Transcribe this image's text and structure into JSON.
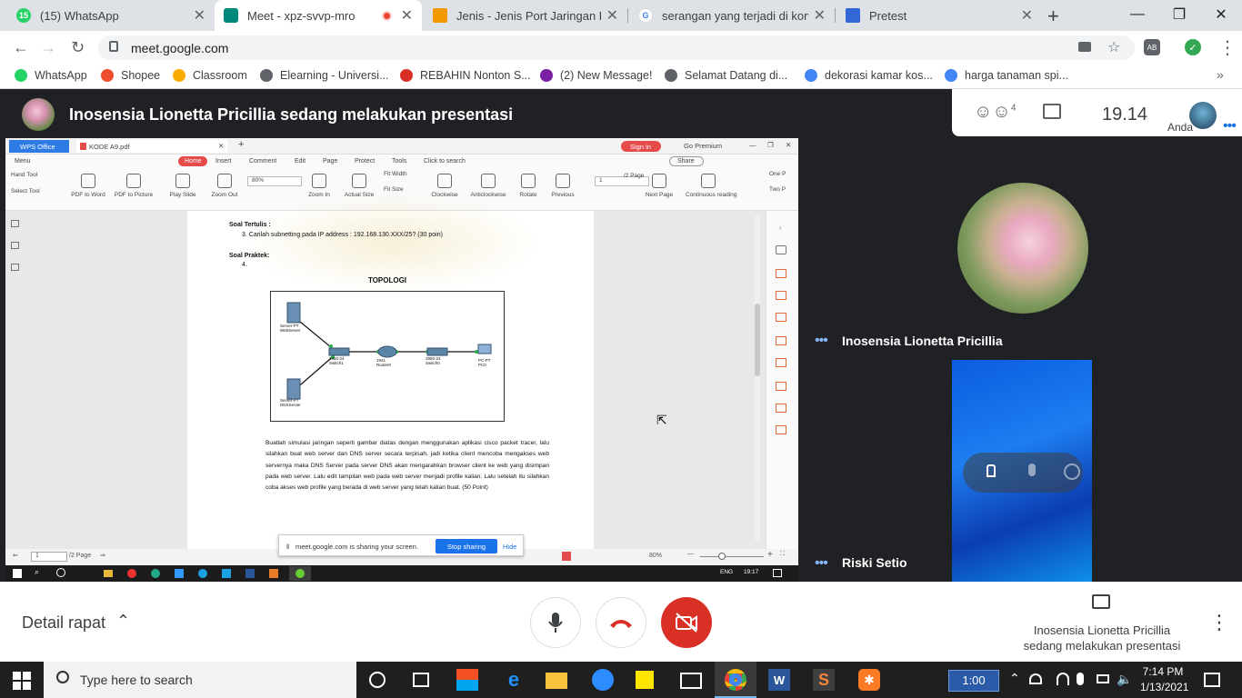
{
  "browser": {
    "tabs": [
      {
        "title": "(15) WhatsApp",
        "badge": "15",
        "color": "#25d366"
      },
      {
        "title": "Meet - xpz-svvp-mro",
        "color": "#00897b"
      },
      {
        "title": "Jenis - Jenis Port Jaringan Kom",
        "color": "#f29900"
      },
      {
        "title": "serangan yang terjadi di komp",
        "color": "#4285f4"
      },
      {
        "title": "Pretest",
        "color": "#3367d6"
      }
    ],
    "new_tab": "+",
    "url": "meet.google.com",
    "bookmarks": [
      {
        "label": "WhatsApp",
        "color": "#25d366"
      },
      {
        "label": "Shopee",
        "color": "#ee4d2d"
      },
      {
        "label": "Classroom",
        "color": "#f9ab00"
      },
      {
        "label": "Elearning - Universi...",
        "color": "#5f6368"
      },
      {
        "label": "REBAHIN Nonton S...",
        "color": "#d93025"
      },
      {
        "label": "(2) New Message!",
        "color": "#7b1fa2"
      },
      {
        "label": "Selamat Datang di...",
        "color": "#5f6368"
      },
      {
        "label": "dekorasi kamar kos...",
        "color": "#4285f4"
      },
      {
        "label": "harga tanaman spi...",
        "color": "#4285f4"
      }
    ]
  },
  "meet": {
    "presenting_text": "Inosensia Lionetta Pricillia sedang melakukan presentasi",
    "participants_count": "4",
    "time": "19.14",
    "self_label": "Anda",
    "tiles": [
      {
        "name": "Inosensia Lionetta Pricillia"
      },
      {
        "name": "Riski Setio"
      }
    ],
    "meeting_details": "Detail rapat",
    "presenter_line1": "Inosensia Lionetta Pricillia",
    "presenter_line2": "sedang melakukan presentasi"
  },
  "wps": {
    "tabs": [
      "WPS Office",
      "KODE A9.pdf"
    ],
    "sign_in": "Sign in",
    "go_premium": "Go Premium",
    "menu_items": [
      "Menu",
      "Home",
      "Insert",
      "Comment",
      "Edit",
      "Page",
      "Protect",
      "Tools",
      "Click to search",
      "Share"
    ],
    "tools": [
      "Hand Tool",
      "Select Tool",
      "PDF to Word",
      "PDF to Picture",
      "Play Slide",
      "Zoom Out",
      "80%",
      "Zoom In",
      "Actual Size",
      "Fit Width",
      "Fit Size",
      "Clockwise",
      "Anticlockwise",
      "Rotate",
      "Previous",
      "1",
      "/2 Page",
      "Next Page",
      "Continuous reading",
      "One P",
      "Two P"
    ],
    "doc": {
      "soal_tertulis": "Soal Tertulis :",
      "q3": "3.    Carilah subnetting pada IP address : 192.168.130.XXX/25? (30 poin)",
      "soal_praktek": "Soal Praktek:",
      "q4": "4.",
      "topologi": "TOPOLOGI",
      "devices": {
        "web_server": "Server-PT\nWebServer",
        "dns_server": "Server-PT\nDNSServer",
        "switch1": "2950-24\nSwitch1",
        "router": "1941\nRouter0",
        "switch0": "2950-24\nSwitch0",
        "pc": "PC-PT\nPC0"
      },
      "paragraph": "Buatlah simulasi jaringan seperti gambar diatas dengan menggunakan aplikasi cisco packet tracer, lalu silahkan buat web server dan DNS server secara terpisah, jadi ketika client mencoba mengakses web servernya maka DNS Server pada server DNS akan mengarahkan browser client ke web yang disimpan pada web server. Lalu edit tampilan web pada web server menjadi profile kalian. Lalu setelah itu silahkan coba akses web profile yang berada di web server yang telah kalian buat.  (50 Point)"
    },
    "status": {
      "page": "1",
      "total": "/2 Page",
      "zoom": "80%"
    },
    "sharing_text": "meet.google.com is sharing your screen.",
    "stop_sharing": "Stop sharing",
    "hide": "Hide",
    "inner_tray": {
      "lang": "ENG",
      "time": "19:17"
    }
  },
  "taskbar": {
    "search_placeholder": "Type here to search",
    "timer": "1:00",
    "time": "7:14 PM",
    "date": "1/13/2021"
  }
}
